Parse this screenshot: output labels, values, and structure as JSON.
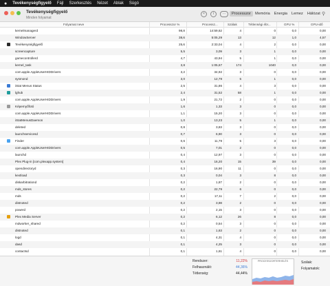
{
  "menubar": {
    "apple": "",
    "app": "Tevékenységfigyelő",
    "items": [
      "Fájl",
      "Szerkesztés",
      "Nézet",
      "Ablak",
      "Súgó"
    ]
  },
  "window": {
    "title": "Tevékenységfigyelő",
    "subtitle": "Minden folyamat",
    "tabs": [
      "Processzor",
      "Memória",
      "Energia",
      "Lemez",
      "Hálózat"
    ],
    "active_tab": "Processzor"
  },
  "columns": {
    "name": "Folyamat neve",
    "cpu": "Processzor %",
    "time": "Processz...",
    "threads": "Szálak",
    "idle": "Tétlenségi ébr...",
    "gpu": "GPU %",
    "gpuid": "GPU-idő"
  },
  "processes": [
    {
      "name": "kernelmanagerd",
      "cpu": "98,8",
      "time": "14:59,62",
      "threads": "4",
      "idle": "0",
      "gpu": "0,0",
      "gpuid": "0,00",
      "icon": ""
    },
    {
      "name": "WindowServer",
      "cpu": "38,6",
      "time": "5:05,29",
      "threads": "13",
      "idle": "12",
      "gpu": "1,0",
      "gpuid": "4,57",
      "icon": ""
    },
    {
      "name": "Tevékenységfigyelő",
      "cpu": "25,6",
      "time": "2:33,04",
      "threads": "4",
      "idle": "2",
      "gpu": "0,0",
      "gpuid": "0,00",
      "icon": "dark"
    },
    {
      "name": "screencapture",
      "cpu": "5,5",
      "time": "3,09",
      "threads": "3",
      "idle": "1",
      "gpu": "0,0",
      "gpuid": "0,00",
      "icon": ""
    },
    {
      "name": "gamecontrollerd",
      "cpu": "4,7",
      "time": "43,94",
      "threads": "5",
      "idle": "1",
      "gpu": "0,0",
      "gpuid": "0,00",
      "icon": ""
    },
    {
      "name": "kernel_task",
      "cpu": "3,8",
      "time": "1:05,67",
      "threads": "174",
      "idle": "1040",
      "gpu": "0,0",
      "gpuid": "0,00",
      "icon": ""
    },
    {
      "name": "com.apple.AppleUserHIDDrivers",
      "cpu": "3,2",
      "time": "34,92",
      "threads": "3",
      "idle": "0",
      "gpu": "0,0",
      "gpuid": "0,00",
      "icon": ""
    },
    {
      "name": "sysmond",
      "cpu": "3,0",
      "time": "12,79",
      "threads": "5",
      "idle": "1",
      "gpu": "0,0",
      "gpuid": "0,00",
      "icon": ""
    },
    {
      "name": "iStat Menus Status",
      "cpu": "2,5",
      "time": "31,86",
      "threads": "4",
      "idle": "3",
      "gpu": "0,0",
      "gpuid": "0,00",
      "icon": "blue"
    },
    {
      "name": "lghub",
      "cpu": "2,4",
      "time": "31,52",
      "threads": "58",
      "idle": "1",
      "gpu": "0,0",
      "gpuid": "0,00",
      "icon": "teal"
    },
    {
      "name": "com.apple.AppleUserHIDDrivers",
      "cpu": "1,9",
      "time": "21,72",
      "threads": "2",
      "idle": "0",
      "gpu": "0,0",
      "gpuid": "0,00",
      "icon": ""
    },
    {
      "name": "Képernyőfotó",
      "cpu": "1,6",
      "time": "1,33",
      "threads": "3",
      "idle": "0",
      "gpu": "0,0",
      "gpuid": "0,00",
      "icon": "grey"
    },
    {
      "name": "com.apple.AppleUserHIDDrivers",
      "cpu": "1,1",
      "time": "15,20",
      "threads": "3",
      "idle": "0",
      "gpu": "0,0",
      "gpuid": "0,00",
      "icon": ""
    },
    {
      "name": "iStatMenusDaemon",
      "cpu": "1,0",
      "time": "13,23",
      "threads": "5",
      "idle": "1",
      "gpu": "0,0",
      "gpuid": "0,00",
      "icon": ""
    },
    {
      "name": "deleted",
      "cpu": "0,8",
      "time": "3,83",
      "threads": "3",
      "idle": "0",
      "gpu": "0,0",
      "gpuid": "0,00",
      "icon": ""
    },
    {
      "name": "launchservicesd",
      "cpu": "0,7",
      "time": "6,90",
      "threads": "3",
      "idle": "0",
      "gpu": "0,0",
      "gpuid": "0,00",
      "icon": ""
    },
    {
      "name": "Finder",
      "cpu": "0,6",
      "time": "11,79",
      "threads": "5",
      "idle": "3",
      "gpu": "0,0",
      "gpuid": "0,00",
      "icon": "finder"
    },
    {
      "name": "com.apple.AppleUserHIDDrivers",
      "cpu": "0,5",
      "time": "7,01",
      "threads": "2",
      "idle": "0",
      "gpu": "0,0",
      "gpuid": "0,00",
      "icon": ""
    },
    {
      "name": "launchd",
      "cpu": "0,4",
      "time": "12,97",
      "threads": "3",
      "idle": "0",
      "gpu": "0,0",
      "gpuid": "0,00",
      "icon": ""
    },
    {
      "name": "Plex Plug-in [com.plexapp.system]",
      "cpu": "0,4",
      "time": "16,20",
      "threads": "15",
      "idle": "39",
      "gpu": "0,0",
      "gpuid": "0,00",
      "icon": ""
    },
    {
      "name": "opendirectoryd",
      "cpu": "0,3",
      "time": "16,90",
      "threads": "11",
      "idle": "0",
      "gpu": "0,0",
      "gpuid": "0,00",
      "icon": ""
    },
    {
      "name": "kextload",
      "cpu": "0,3",
      "time": "0,04",
      "threads": "3",
      "idle": "8",
      "gpu": "0,0",
      "gpuid": "0,00",
      "icon": ""
    },
    {
      "name": "diskarbitrationd",
      "cpu": "0,2",
      "time": "1,87",
      "threads": "2",
      "idle": "0",
      "gpu": "0,0",
      "gpuid": "0,00",
      "icon": ""
    },
    {
      "name": "mds_stores",
      "cpu": "0,2",
      "time": "22,79",
      "threads": "6",
      "idle": "0",
      "gpu": "0,0",
      "gpuid": "0,00",
      "icon": ""
    },
    {
      "name": "mds",
      "cpu": "0,2",
      "time": "17,11",
      "threads": "7",
      "idle": "2",
      "gpu": "0,0",
      "gpuid": "0,00",
      "icon": ""
    },
    {
      "name": "distnoted",
      "cpu": "0,2",
      "time": "3,98",
      "threads": "2",
      "idle": "0",
      "gpu": "0,0",
      "gpuid": "0,00",
      "icon": ""
    },
    {
      "name": "powerd",
      "cpu": "0,2",
      "time": "2,15",
      "threads": "3",
      "idle": "0",
      "gpu": "0,0",
      "gpuid": "0,00",
      "icon": ""
    },
    {
      "name": "Plex Media Server",
      "cpu": "0,2",
      "time": "6,12",
      "threads": "26",
      "idle": "8",
      "gpu": "0,0",
      "gpuid": "0,00",
      "icon": "plex"
    },
    {
      "name": "mdworker_shared",
      "cpu": "0,2",
      "time": "0,54",
      "threads": "3",
      "idle": "0",
      "gpu": "0,0",
      "gpuid": "0,00",
      "icon": ""
    },
    {
      "name": "distnoted",
      "cpu": "0,1",
      "time": "1,63",
      "threads": "2",
      "idle": "0",
      "gpu": "0,0",
      "gpuid": "0,00",
      "icon": ""
    },
    {
      "name": "logd",
      "cpu": "0,1",
      "time": "4,31",
      "threads": "4",
      "idle": "0",
      "gpu": "0,0",
      "gpuid": "0,00",
      "icon": ""
    },
    {
      "name": "dasd",
      "cpu": "0,1",
      "time": "4,25",
      "threads": "3",
      "idle": "0",
      "gpu": "0,0",
      "gpuid": "0,00",
      "icon": ""
    },
    {
      "name": "contactsd",
      "cpu": "0,1",
      "time": "1,61",
      "threads": "4",
      "idle": "0",
      "gpu": "0,0",
      "gpuid": "0,00",
      "icon": ""
    }
  ],
  "footer": {
    "system_label": "Rendszer:",
    "system_value": "11,22%",
    "user_label": "Felhasználó:",
    "user_value": "44,36%",
    "idle_label": "Tétlenség:",
    "idle_value": "44,44%",
    "graph_title": "PROCESSZORTERHELÉS",
    "threads_label": "Szálak:",
    "processes_label": "Folyamatok:",
    "system_color": "#d0363b",
    "user_color": "#3b7bd6"
  }
}
